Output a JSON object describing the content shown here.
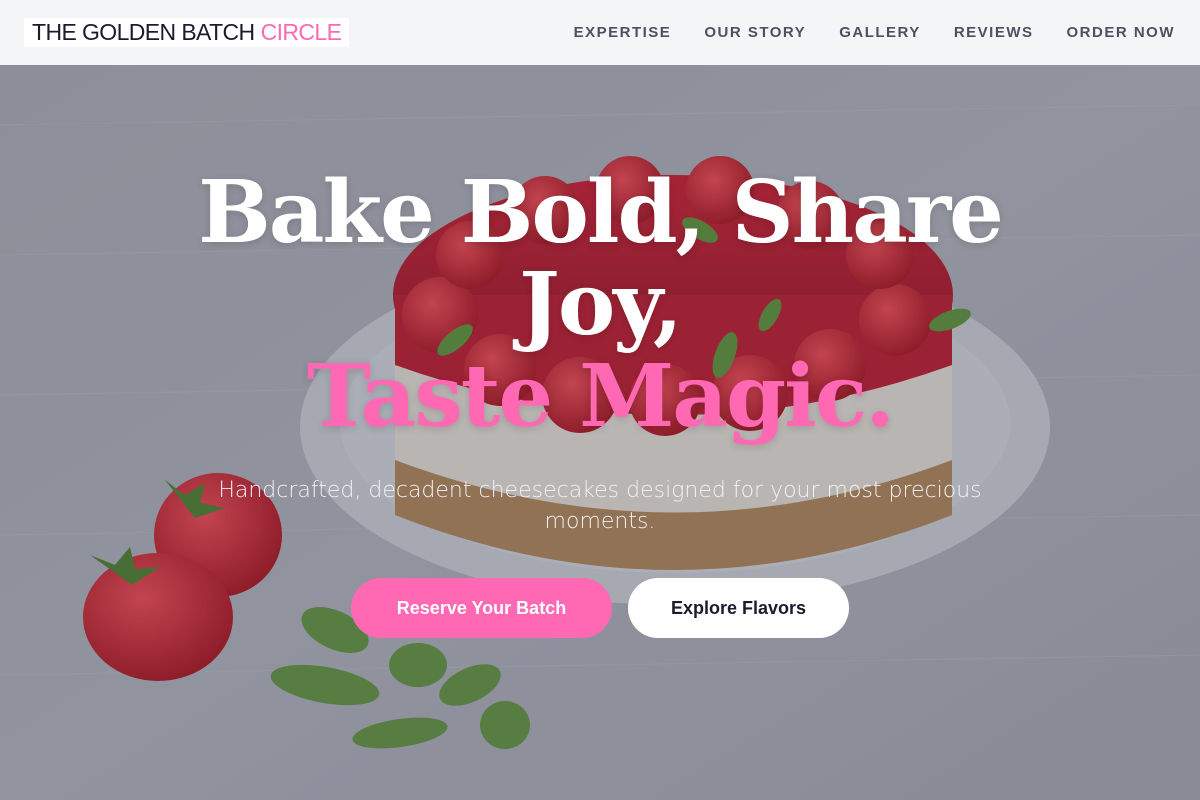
{
  "nav": {
    "logo_primary": "THE GOLDEN BATCH",
    "logo_accent": "CIRCLE",
    "links": [
      "EXPERTISE",
      "OUR STORY",
      "GALLERY",
      "REVIEWS",
      "ORDER NOW"
    ]
  },
  "hero": {
    "headline_line1": "Bake Bold, Share",
    "headline_line2": "Joy,",
    "headline_line3": "Taste Magic.",
    "subheadline": "Handcrafted, decadent cheesecakes designed for your most precious moments.",
    "primary_button": "Reserve Your Batch",
    "secondary_button": "Explore Flavors",
    "background_image": "strawberry-cheesecake-photo"
  },
  "colors": {
    "accent": "#ff69b4",
    "nav_bg": "#f4f5f7",
    "text_dark": "#1a1c2e",
    "nav_link": "#4a5163"
  }
}
